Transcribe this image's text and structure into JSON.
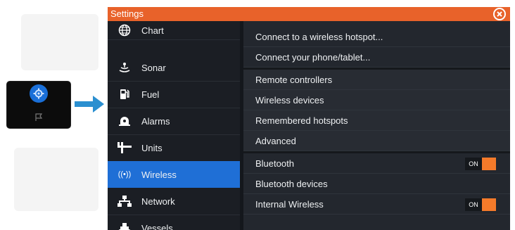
{
  "dialog": {
    "title": "Settings",
    "close_icon": "close-circle-icon"
  },
  "sidebar": {
    "items": [
      {
        "label": "Chart",
        "icon": "globe-icon",
        "active": false
      },
      {
        "label": "Sonar",
        "icon": "sonar-icon",
        "active": false
      },
      {
        "label": "Fuel",
        "icon": "fuel-pump-icon",
        "active": false
      },
      {
        "label": "Alarms",
        "icon": "alarm-bell-icon",
        "active": false
      },
      {
        "label": "Units",
        "icon": "units-ruler-icon",
        "active": false
      },
      {
        "label": "Wireless",
        "icon": "wireless-icon",
        "active": true,
        "glyph": "((•))"
      },
      {
        "label": "Network",
        "icon": "network-icon",
        "active": false
      },
      {
        "label": "Vessels",
        "icon": "vessel-icon",
        "active": false
      }
    ]
  },
  "content": {
    "rows": [
      {
        "label": "Connect to a wireless hotspot..."
      },
      {
        "label": "Connect your phone/tablet..."
      },
      {
        "label": "Remote controllers"
      },
      {
        "label": "Wireless devices"
      },
      {
        "label": "Remembered hotspots"
      },
      {
        "label": "Advanced"
      },
      {
        "label": "Bluetooth",
        "toggle": "ON"
      },
      {
        "label": "Bluetooth devices"
      },
      {
        "label": "Internal Wireless",
        "toggle": "ON"
      }
    ]
  },
  "colors": {
    "title_bar": "#e8622a",
    "active_item": "#1f6fd6",
    "toggle_on": "#f47a2a",
    "arrow": "#2a8fd0"
  }
}
